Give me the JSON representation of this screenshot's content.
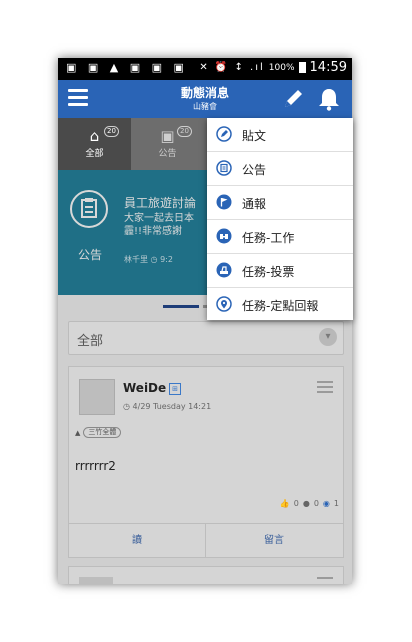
{
  "status_bar": {
    "battery": "100%",
    "time": "14:59"
  },
  "app_bar": {
    "title": "動態消息",
    "subtitle": "山豬會"
  },
  "tabs": [
    {
      "label": "全部",
      "count": "20",
      "active": true
    },
    {
      "label": "公告",
      "count": "20",
      "active": false
    }
  ],
  "banner": {
    "title": "員工旅遊討論",
    "line1": "大家一起去日本",
    "line2": "霾!!非常感謝",
    "author": "林千里",
    "time": "9:2",
    "type_label": "公告"
  },
  "filter": {
    "label": "全部"
  },
  "post": {
    "author": "WeiDe",
    "date": "4/29 Tuesday 14:21",
    "group_tag": "三竹全體",
    "body": "rrrrrrr2",
    "likes": "0",
    "comments": "0",
    "views": "1",
    "read_label": "讀",
    "comment_label": "留言"
  },
  "menu": {
    "items": [
      {
        "label": "貼文",
        "icon": "post-icon"
      },
      {
        "label": "公告",
        "icon": "announcement-icon"
      },
      {
        "label": "通報",
        "icon": "flag-icon"
      },
      {
        "label": "任務-工作",
        "icon": "task-work-icon"
      },
      {
        "label": "任務-投票",
        "icon": "vote-icon"
      },
      {
        "label": "任務-定點回報",
        "icon": "location-icon"
      }
    ]
  },
  "colors": {
    "app_bar": "#2a64b6",
    "accent_icon": "#2a64b6",
    "banner": "#1f6f86",
    "overlay_dim": "#cfcfcf"
  }
}
